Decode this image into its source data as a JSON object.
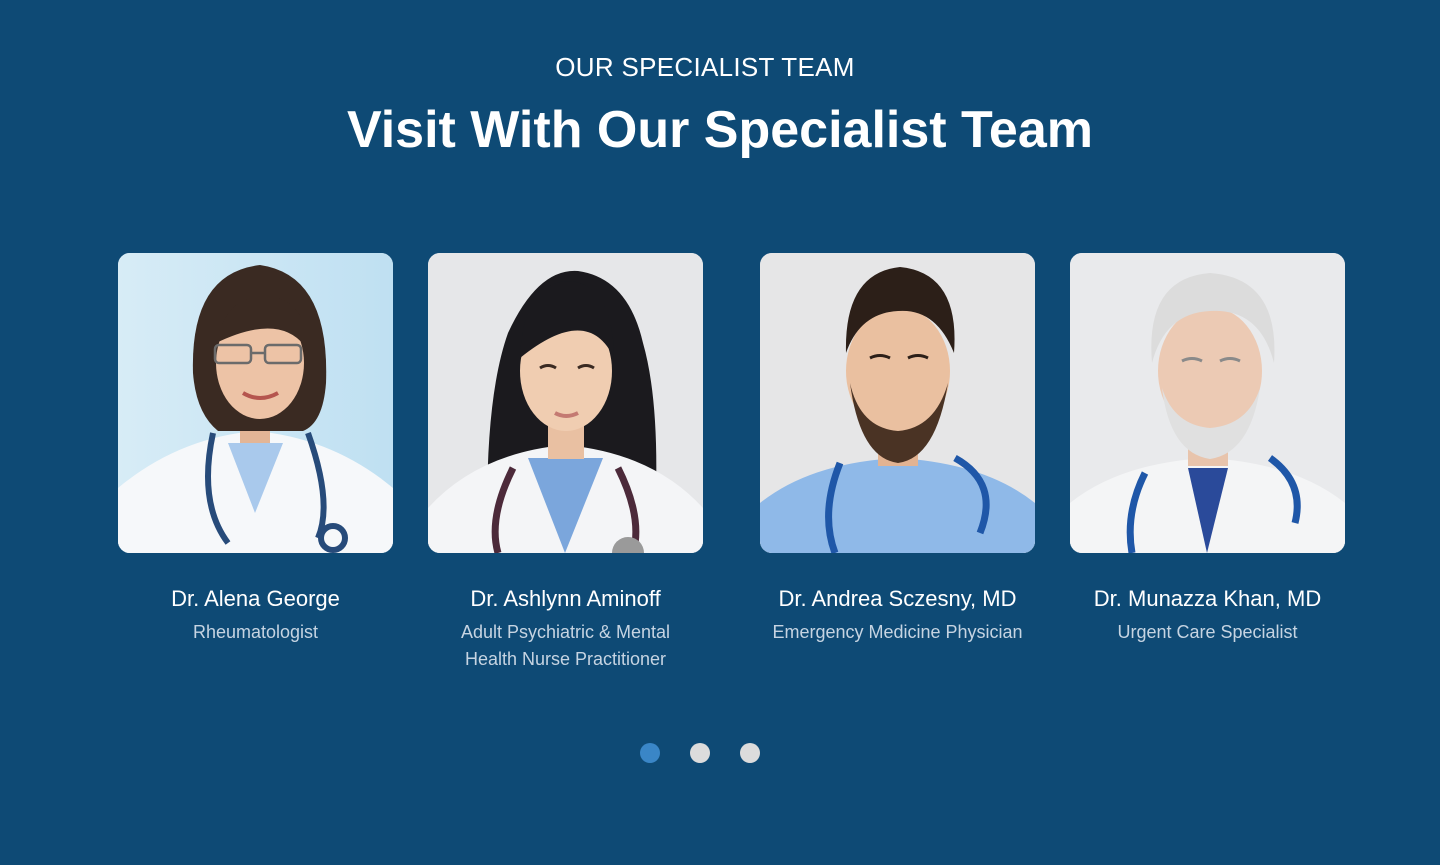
{
  "section": {
    "eyebrow": "OUR SPECIALIST TEAM",
    "title": "Visit With Our Specialist Team"
  },
  "doctors": [
    {
      "name": "Dr. Alena George",
      "role": "Rheumatologist",
      "photo_icon": "doctor-photo-woman"
    },
    {
      "name": "Dr. Ashlynn Aminoff",
      "role": "Adult Psychiatric & Mental Health Nurse Practitioner",
      "photo_icon": "doctor-photo-woman"
    },
    {
      "name": "Dr. Andrea Sczesny, MD",
      "role": "Emergency Medicine Physician",
      "photo_icon": "doctor-photo-man"
    },
    {
      "name": "Dr. Munazza Khan, MD",
      "role": "Urgent Care Specialist",
      "photo_icon": "doctor-photo-man"
    }
  ],
  "carousel": {
    "pages": 3,
    "active_page": 1
  },
  "colors": {
    "background": "#0e4a75",
    "dot_active": "#3a86c7",
    "dot_inactive": "#dcdcdc",
    "role_text": "#c6d4e2"
  }
}
